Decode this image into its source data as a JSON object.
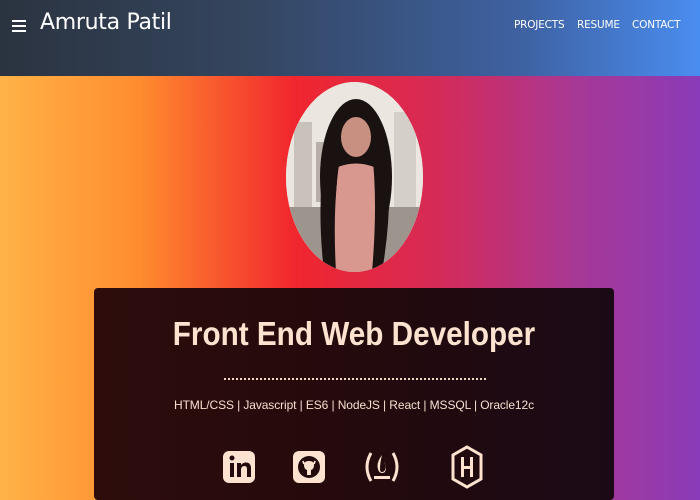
{
  "navbar": {
    "menu_icon": "hamburger-menu-icon",
    "brand": "Amruta Patil",
    "links": [
      "PROJECTS",
      "RESUME",
      "CONTACT"
    ]
  },
  "profile": {
    "image": "profile-photo"
  },
  "card": {
    "title": "Front End Web Developer",
    "skills": "HTML/CSS | Javascript | ES6 | NodeJS | React | MSSQL | Oracle12c",
    "social_icons": [
      "linkedin-icon",
      "github-icon",
      "freecodecamp-icon",
      "hackerrank-icon"
    ]
  },
  "colors": {
    "accent_text": "#fde3cf",
    "card_bg": "#230a0c",
    "navbar_start": "#2b3340",
    "navbar_end": "#4a8df0"
  }
}
